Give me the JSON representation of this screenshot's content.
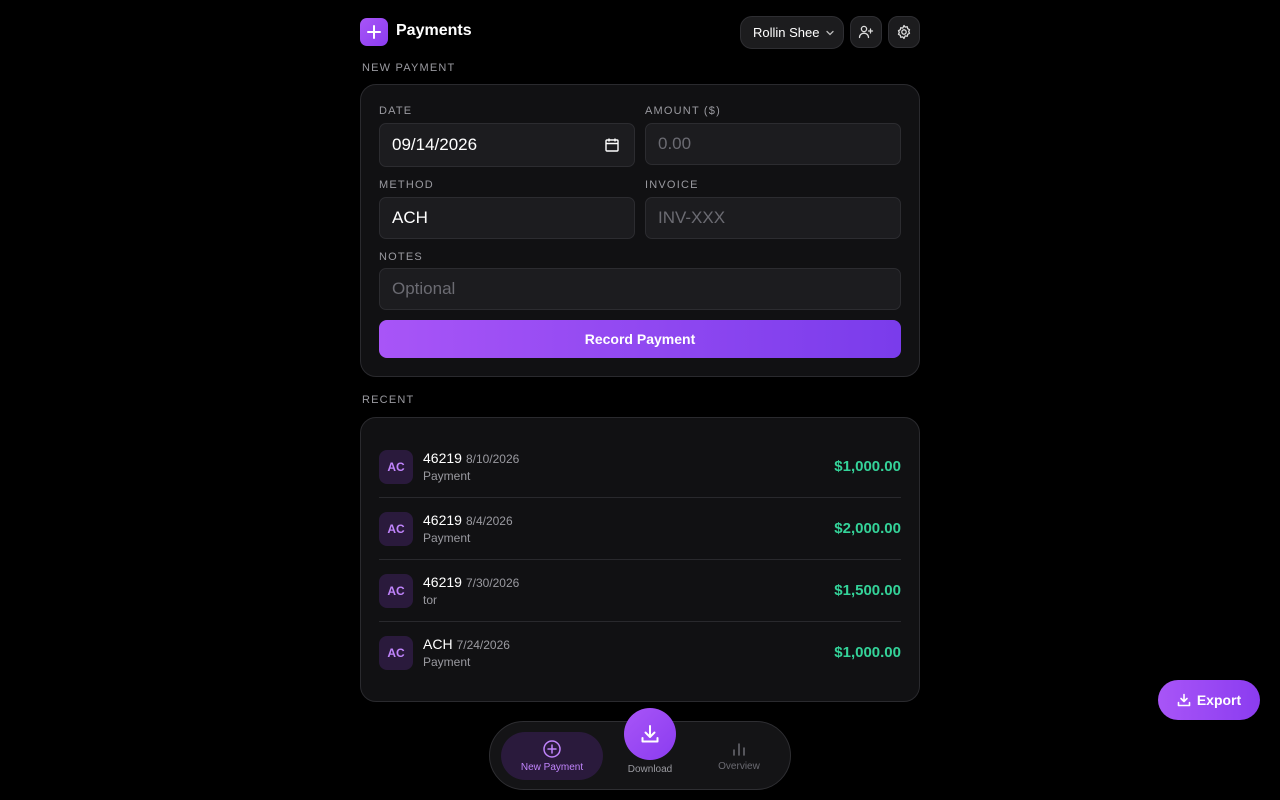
{
  "app": {
    "title": "Payments"
  },
  "header": {
    "user_name": "Rollin Shee"
  },
  "new_payment": {
    "section_label": "NEW PAYMENT",
    "date_label": "DATE",
    "date_value": "09/14/2026",
    "amount_label": "AMOUNT ($)",
    "amount_placeholder": "0.00",
    "method_label": "METHOD",
    "method_value": "ACH",
    "invoice_label": "INVOICE",
    "invoice_placeholder": "INV-XXX",
    "notes_label": "NOTES",
    "notes_placeholder": "Optional",
    "submit_label": "Record Payment"
  },
  "recent": {
    "section_label": "RECENT",
    "items": [
      {
        "avatar": "AC",
        "title": "46219",
        "date": "8/10/2026",
        "sub": "Payment",
        "amount": "$1,000.00"
      },
      {
        "avatar": "AC",
        "title": "46219",
        "date": "8/4/2026",
        "sub": "Payment",
        "amount": "$2,000.00"
      },
      {
        "avatar": "AC",
        "title": "46219",
        "date": "7/30/2026",
        "sub": "tor",
        "amount": "$1,500.00"
      },
      {
        "avatar": "AC",
        "title": "ACH",
        "date": "7/24/2026",
        "sub": "Payment",
        "amount": "$1,000.00"
      }
    ]
  },
  "nav": {
    "new_payment": "New Payment",
    "download": "Download",
    "overview": "Overview"
  },
  "export_label": "Export",
  "colors": {
    "accent": "#a855f7",
    "amount": "#34d399",
    "background": "#000000"
  },
  "icons": [
    "plus-icon",
    "chevron-down-icon",
    "add-user-icon",
    "gear-icon",
    "calendar-icon",
    "plus-circle-icon",
    "download-icon",
    "bar-chart-icon"
  ]
}
